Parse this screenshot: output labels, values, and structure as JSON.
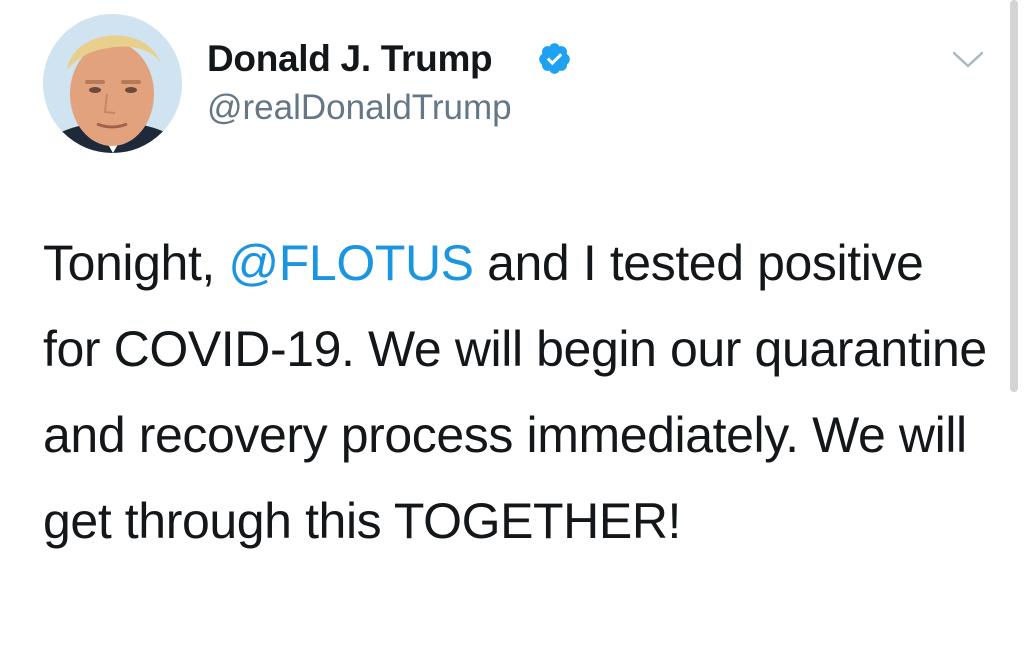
{
  "author": {
    "display_name": "Donald J. Trump",
    "handle": "@realDonaldTrump",
    "verified": true
  },
  "tweet": {
    "text_before_mention": "Tonight, ",
    "mention": "@FLOTUS",
    "text_after_mention": " and I tested positive for COVID-19. We will begin our quarantine and recovery process immediately. We will get through this TOGETHER!"
  },
  "icons": {
    "verified": "verified-badge-icon",
    "menu": "chevron-down-icon"
  },
  "colors": {
    "text": "#14171a",
    "secondary": "#657786",
    "link": "#1b95e0",
    "verified": "#1da1f2"
  }
}
